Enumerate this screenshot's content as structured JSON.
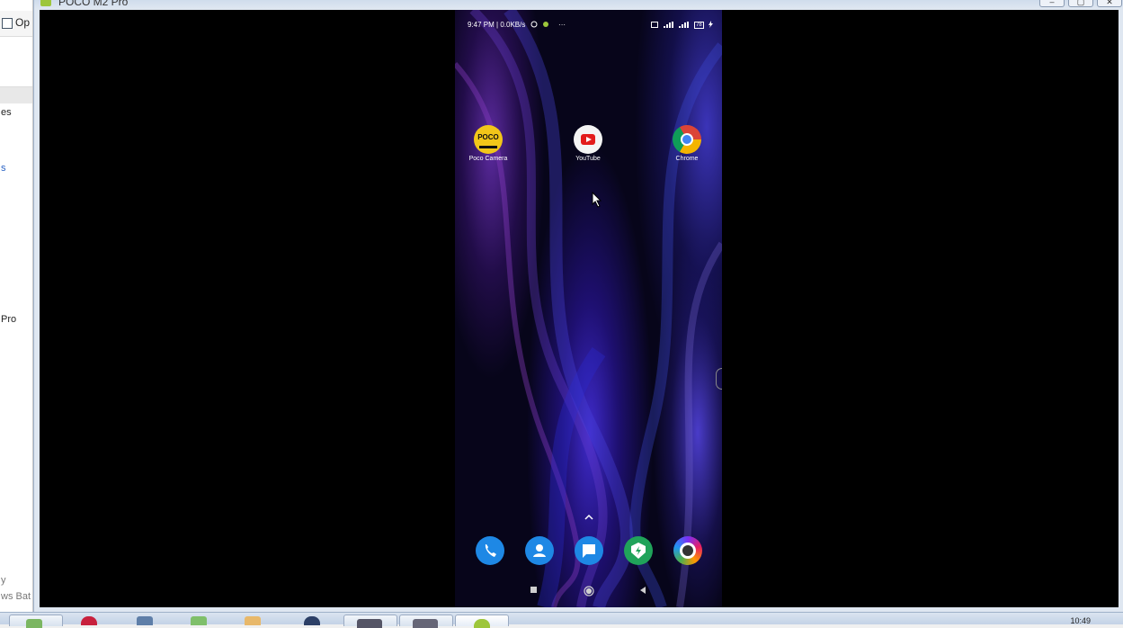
{
  "background_window": {
    "toolbar_fragment": "Op",
    "fragments": [
      "es",
      "s",
      "Pro",
      "y",
      "ws Bat"
    ]
  },
  "emulator": {
    "title": "POCO M2 Pro",
    "window_buttons": [
      "–",
      "▢",
      "✕"
    ]
  },
  "phone": {
    "status_bar": {
      "time_speed": "9:47 PM | 0.0KB/s",
      "more": "···",
      "battery": "78"
    },
    "apps": [
      {
        "label": "Poco Camera",
        "icon": "poco-camera-icon",
        "badge": "POCO"
      },
      {
        "label": "YouTube",
        "icon": "youtube-icon"
      },
      {
        "label": "Chrome",
        "icon": "chrome-icon"
      }
    ],
    "dock": [
      {
        "name": "phone-icon"
      },
      {
        "name": "contacts-icon"
      },
      {
        "name": "messages-icon"
      },
      {
        "name": "security-icon"
      },
      {
        "name": "browser-icon"
      }
    ],
    "nav": [
      "recents-button",
      "home-button",
      "back-button"
    ]
  },
  "taskbar": {
    "clock": "10:49"
  },
  "colors": {
    "emulator_bg": "#000000",
    "wallpaper_accent": "#3e2ac9",
    "taskbar": "#c3d2e6"
  }
}
